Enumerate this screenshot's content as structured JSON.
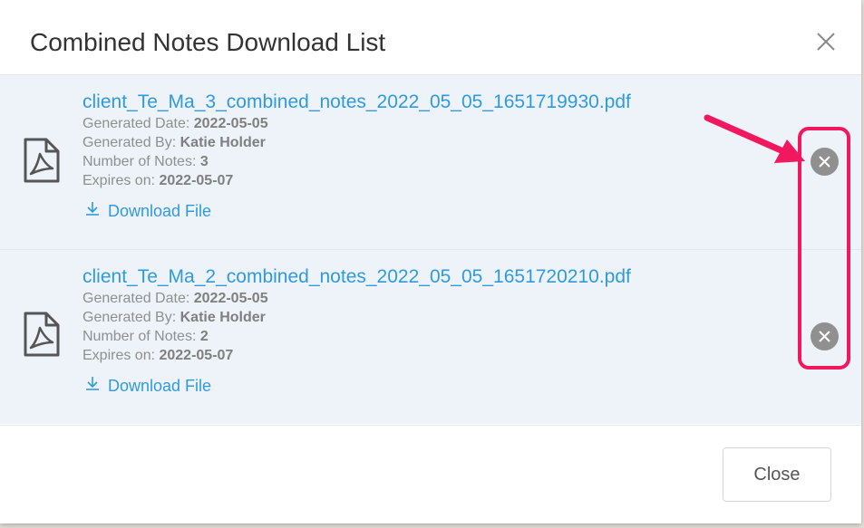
{
  "modal": {
    "title": "Combined Notes Download List",
    "close_icon": "close-icon"
  },
  "labels": {
    "generated_date": "Generated Date: ",
    "generated_by": "Generated By: ",
    "number_of_notes": "Number of Notes: ",
    "expires_on": "Expires on: ",
    "download": "Download File"
  },
  "files": [
    {
      "name": "client_Te_Ma_3_combined_notes_2022_05_05_1651719930.pdf",
      "generated_date": "2022-05-05",
      "generated_by": "Katie Holder",
      "number_of_notes": "3",
      "expires_on": "2022-05-07"
    },
    {
      "name": "client_Te_Ma_2_combined_notes_2022_05_05_1651720210.pdf",
      "generated_date": "2022-05-05",
      "generated_by": "Katie Holder",
      "number_of_notes": "2",
      "expires_on": "2022-05-07"
    }
  ],
  "footer": {
    "close_label": "Close"
  },
  "icons": {
    "file": "pdf-file-icon",
    "download": "download-icon",
    "remove": "remove-circle-icon"
  },
  "colors": {
    "link": "#2f9bde",
    "row_background": "#eef3f9",
    "remove_button": "#909090",
    "annotation": "#f1185f"
  }
}
